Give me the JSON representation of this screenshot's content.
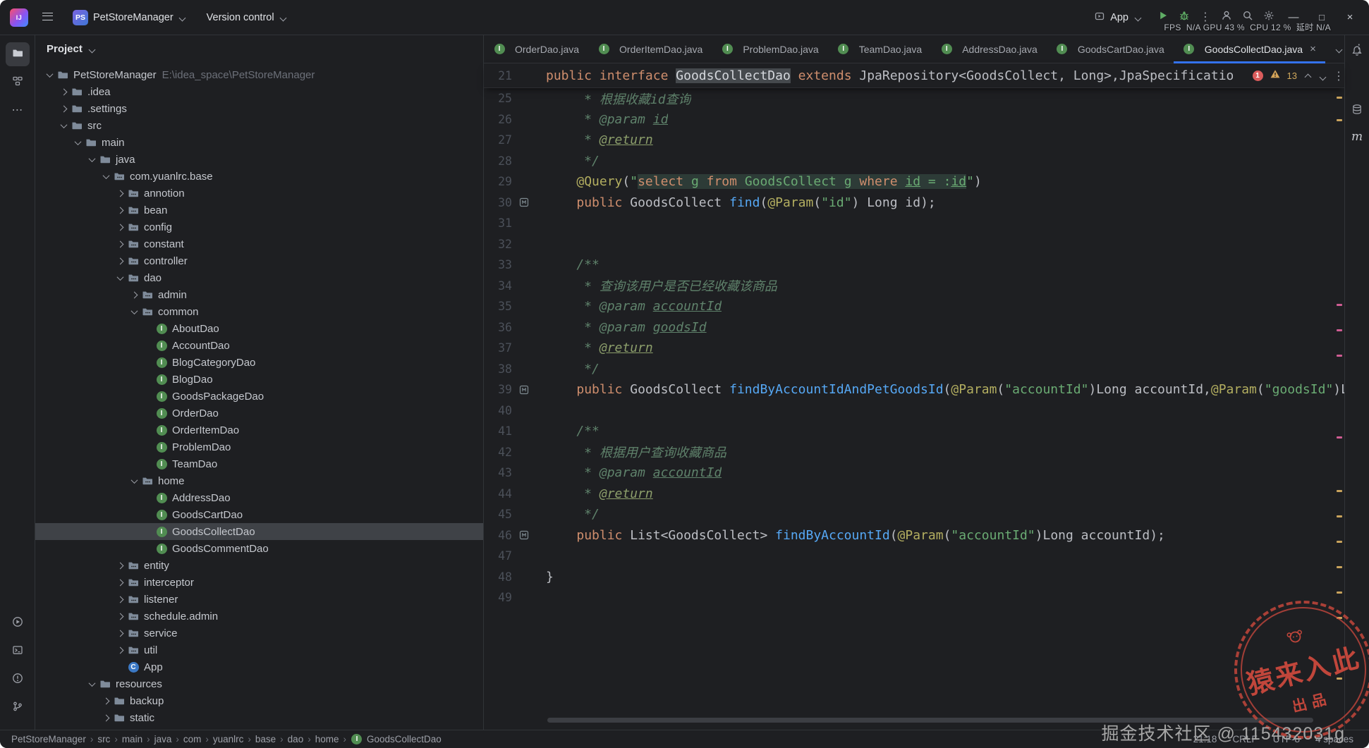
{
  "icons": {
    "logo_text": "IJ",
    "more": "⋯",
    "kebab": "⋮",
    "minimize": "—",
    "maximize": "□",
    "close": "×",
    "interface_letter": "I",
    "class_letter": "C",
    "maven_letter": "m",
    "breadcrumb_sep": "›"
  },
  "title_bar": {
    "project_badge": "PS",
    "project_name": "PetStoreManager",
    "version_control": "Version control",
    "run_config": "App",
    "perf_overlay": "FPS  N/A GPU 43 %  CPU 12 %  延时 N/A"
  },
  "project_panel": {
    "title": "Project",
    "tree": [
      {
        "level": 0,
        "chev": "down",
        "icon": "folder",
        "label": "PetStoreManager",
        "hint": "E:\\idea_space\\PetStoreManager"
      },
      {
        "level": 1,
        "chev": "right",
        "icon": "folder",
        "label": ".idea"
      },
      {
        "level": 1,
        "chev": "right",
        "icon": "folder",
        "label": ".settings"
      },
      {
        "level": 1,
        "chev": "down",
        "icon": "folder",
        "label": "src"
      },
      {
        "level": 2,
        "chev": "down",
        "icon": "folder",
        "label": "main"
      },
      {
        "level": 3,
        "chev": "down",
        "icon": "folder",
        "label": "java"
      },
      {
        "level": 4,
        "chev": "down",
        "icon": "package",
        "label": "com.yuanlrc.base"
      },
      {
        "level": 5,
        "chev": "right",
        "icon": "package",
        "label": "annotion"
      },
      {
        "level": 5,
        "chev": "right",
        "icon": "package",
        "label": "bean"
      },
      {
        "level": 5,
        "chev": "right",
        "icon": "package",
        "label": "config"
      },
      {
        "level": 5,
        "chev": "right",
        "icon": "package",
        "label": "constant"
      },
      {
        "level": 5,
        "chev": "right",
        "icon": "package",
        "label": "controller"
      },
      {
        "level": 5,
        "chev": "down",
        "icon": "package",
        "label": "dao"
      },
      {
        "level": 6,
        "chev": "right",
        "icon": "package",
        "label": "admin"
      },
      {
        "level": 6,
        "chev": "down",
        "icon": "package",
        "label": "common"
      },
      {
        "level": 7,
        "icon": "interface",
        "label": "AboutDao"
      },
      {
        "level": 7,
        "icon": "interface",
        "label": "AccountDao"
      },
      {
        "level": 7,
        "icon": "interface",
        "label": "BlogCategoryDao"
      },
      {
        "level": 7,
        "icon": "interface",
        "label": "BlogDao"
      },
      {
        "level": 7,
        "icon": "interface",
        "label": "GoodsPackageDao"
      },
      {
        "level": 7,
        "icon": "interface",
        "label": "OrderDao"
      },
      {
        "level": 7,
        "icon": "interface",
        "label": "OrderItemDao"
      },
      {
        "level": 7,
        "icon": "interface",
        "label": "ProblemDao"
      },
      {
        "level": 7,
        "icon": "interface",
        "label": "TeamDao"
      },
      {
        "level": 6,
        "chev": "down",
        "icon": "package",
        "label": "home"
      },
      {
        "level": 7,
        "icon": "interface",
        "label": "AddressDao"
      },
      {
        "level": 7,
        "icon": "interface",
        "label": "GoodsCartDao"
      },
      {
        "level": 7,
        "icon": "interface",
        "label": "GoodsCollectDao",
        "selected": true
      },
      {
        "level": 7,
        "icon": "interface",
        "label": "GoodsCommentDao"
      },
      {
        "level": 5,
        "chev": "right",
        "icon": "package",
        "label": "entity"
      },
      {
        "level": 5,
        "chev": "right",
        "icon": "package",
        "label": "interceptor"
      },
      {
        "level": 5,
        "chev": "right",
        "icon": "package",
        "label": "listener"
      },
      {
        "level": 5,
        "chev": "right",
        "icon": "package",
        "label": "schedule.admin"
      },
      {
        "level": 5,
        "chev": "right",
        "icon": "package",
        "label": "service"
      },
      {
        "level": 5,
        "chev": "right",
        "icon": "package",
        "label": "util"
      },
      {
        "level": 5,
        "icon": "class",
        "label": "App"
      },
      {
        "level": 3,
        "chev": "down",
        "icon": "folder",
        "label": "resources"
      },
      {
        "level": 4,
        "chev": "right",
        "icon": "folder",
        "label": "backup"
      },
      {
        "level": 4,
        "chev": "right",
        "icon": "folder",
        "label": "static"
      }
    ]
  },
  "editor_tabs": {
    "tabs": [
      {
        "label": "OrderDao.java"
      },
      {
        "label": "OrderItemDao.java"
      },
      {
        "label": "ProblemDao.java"
      },
      {
        "label": "TeamDao.java"
      },
      {
        "label": "AddressDao.java"
      },
      {
        "label": "GoodsCartDao.java"
      },
      {
        "label": "GoodsCollectDao.java",
        "active": true,
        "closable": true
      }
    ]
  },
  "editor": {
    "badges": {
      "errors": "1",
      "warnings": "13"
    },
    "sticky": {
      "num": "21",
      "t": [
        [
          "k",
          "public"
        ],
        [
          "p",
          " "
        ],
        [
          "k",
          "interface"
        ],
        [
          "p",
          " "
        ],
        [
          "hl",
          "GoodsCollectDao"
        ],
        [
          "p",
          " "
        ],
        [
          "k",
          "extends"
        ],
        [
          "p",
          " JpaRepository<GoodsCollect, Long>,JpaSpecification"
        ]
      ]
    },
    "lines": [
      {
        "n": 25,
        "t": [
          [
            "d",
            "     * 根据收藏id查询"
          ]
        ]
      },
      {
        "n": 26,
        "t": [
          [
            "d",
            "     * "
          ],
          [
            "dt",
            "@param"
          ],
          [
            "d",
            " "
          ],
          [
            "dp",
            "id"
          ]
        ]
      },
      {
        "n": 27,
        "t": [
          [
            "d",
            "     * "
          ],
          [
            "du",
            "@return"
          ]
        ]
      },
      {
        "n": 28,
        "t": [
          [
            "d",
            "     */"
          ]
        ]
      },
      {
        "n": 29,
        "t": [
          [
            "p",
            "    "
          ],
          [
            "a",
            "@Query"
          ],
          [
            "p",
            "("
          ],
          [
            "s",
            "\""
          ],
          [
            "sk",
            "select"
          ],
          [
            "si",
            " g "
          ],
          [
            "sk",
            "from"
          ],
          [
            "si",
            " GoodsCollect g "
          ],
          [
            "sk",
            "where"
          ],
          [
            "si",
            " "
          ],
          [
            "su",
            "id"
          ],
          [
            "si",
            " = :"
          ],
          [
            "su",
            "id"
          ],
          [
            "s",
            "\""
          ],
          [
            "p",
            ")"
          ]
        ]
      },
      {
        "n": 30,
        "marker": true,
        "t": [
          [
            "p",
            "    "
          ],
          [
            "k",
            "public"
          ],
          [
            "p",
            " GoodsCollect "
          ],
          [
            "m",
            "find"
          ],
          [
            "p",
            "("
          ],
          [
            "a",
            "@Param"
          ],
          [
            "p",
            "("
          ],
          [
            "s",
            "\"id\""
          ],
          [
            "p",
            ") Long id);"
          ]
        ]
      },
      {
        "n": 31,
        "t": []
      },
      {
        "n": 32,
        "t": []
      },
      {
        "n": 33,
        "t": [
          [
            "d",
            "    /**"
          ]
        ]
      },
      {
        "n": 34,
        "t": [
          [
            "d",
            "     * 查询该用户是否已经收藏该商品"
          ]
        ]
      },
      {
        "n": 35,
        "t": [
          [
            "d",
            "     * "
          ],
          [
            "dt",
            "@param"
          ],
          [
            "d",
            " "
          ],
          [
            "dp",
            "accountId"
          ]
        ]
      },
      {
        "n": 36,
        "t": [
          [
            "d",
            "     * "
          ],
          [
            "dt",
            "@param"
          ],
          [
            "d",
            " "
          ],
          [
            "dp",
            "goodsId"
          ]
        ]
      },
      {
        "n": 37,
        "t": [
          [
            "d",
            "     * "
          ],
          [
            "du",
            "@return"
          ]
        ]
      },
      {
        "n": 38,
        "t": [
          [
            "d",
            "     */"
          ]
        ]
      },
      {
        "n": 39,
        "marker": true,
        "t": [
          [
            "p",
            "    "
          ],
          [
            "k",
            "public"
          ],
          [
            "p",
            " GoodsCollect "
          ],
          [
            "m",
            "findByAccountIdAndPetGoodsId"
          ],
          [
            "p",
            "("
          ],
          [
            "a",
            "@Param"
          ],
          [
            "p",
            "("
          ],
          [
            "s",
            "\"accountId\""
          ],
          [
            "p",
            ")Long accountId,"
          ],
          [
            "a",
            "@Param"
          ],
          [
            "p",
            "("
          ],
          [
            "s",
            "\"goodsId\""
          ],
          [
            "p",
            ")Long goodsId);"
          ]
        ]
      },
      {
        "n": 40,
        "t": []
      },
      {
        "n": 41,
        "t": [
          [
            "d",
            "    /**"
          ]
        ]
      },
      {
        "n": 42,
        "t": [
          [
            "d",
            "     * 根据用户查询收藏商品"
          ]
        ]
      },
      {
        "n": 43,
        "t": [
          [
            "d",
            "     * "
          ],
          [
            "dt",
            "@param"
          ],
          [
            "d",
            " "
          ],
          [
            "dp",
            "accountId"
          ]
        ]
      },
      {
        "n": 44,
        "t": [
          [
            "d",
            "     * "
          ],
          [
            "du",
            "@return"
          ]
        ]
      },
      {
        "n": 45,
        "t": [
          [
            "d",
            "     */"
          ]
        ]
      },
      {
        "n": 46,
        "marker": true,
        "t": [
          [
            "p",
            "    "
          ],
          [
            "k",
            "public"
          ],
          [
            "p",
            " List<GoodsCollect> "
          ],
          [
            "m",
            "findByAccountId"
          ],
          [
            "p",
            "("
          ],
          [
            "a",
            "@Param"
          ],
          [
            "p",
            "("
          ],
          [
            "s",
            "\"accountId\""
          ],
          [
            "p",
            ")Long accountId);"
          ]
        ]
      },
      {
        "n": 47,
        "t": []
      },
      {
        "n": 48,
        "t": [
          [
            "p",
            "}"
          ]
        ]
      },
      {
        "n": 49,
        "t": []
      }
    ],
    "stripe_marks": [
      {
        "t": 12,
        "c": "warn"
      },
      {
        "t": 44,
        "c": "warn"
      },
      {
        "t": 306,
        "c": "info"
      },
      {
        "t": 342,
        "c": "info"
      },
      {
        "t": 378,
        "c": "info"
      },
      {
        "t": 494,
        "c": "info"
      },
      {
        "t": 570,
        "c": "warn"
      },
      {
        "t": 606,
        "c": "warn"
      },
      {
        "t": 642,
        "c": "warn"
      },
      {
        "t": 678,
        "c": "warn"
      },
      {
        "t": 714,
        "c": "warn"
      },
      {
        "t": 750,
        "c": "warn"
      },
      {
        "t": 836,
        "c": "warn"
      }
    ]
  },
  "status_bar": {
    "breadcrumbs": [
      "PetStoreManager",
      "src",
      "main",
      "java",
      "com",
      "yuanlrc",
      "base",
      "dao",
      "home"
    ],
    "file_crumb": "GoodsCollectDao",
    "right": [
      "21:18",
      "CRLF",
      "UTF-8",
      "4 spaces"
    ]
  },
  "watermark": {
    "community": "掘金技术社区 @ 115432031g",
    "stamp_main": "猿来入此",
    "stamp_sub": "出品"
  }
}
